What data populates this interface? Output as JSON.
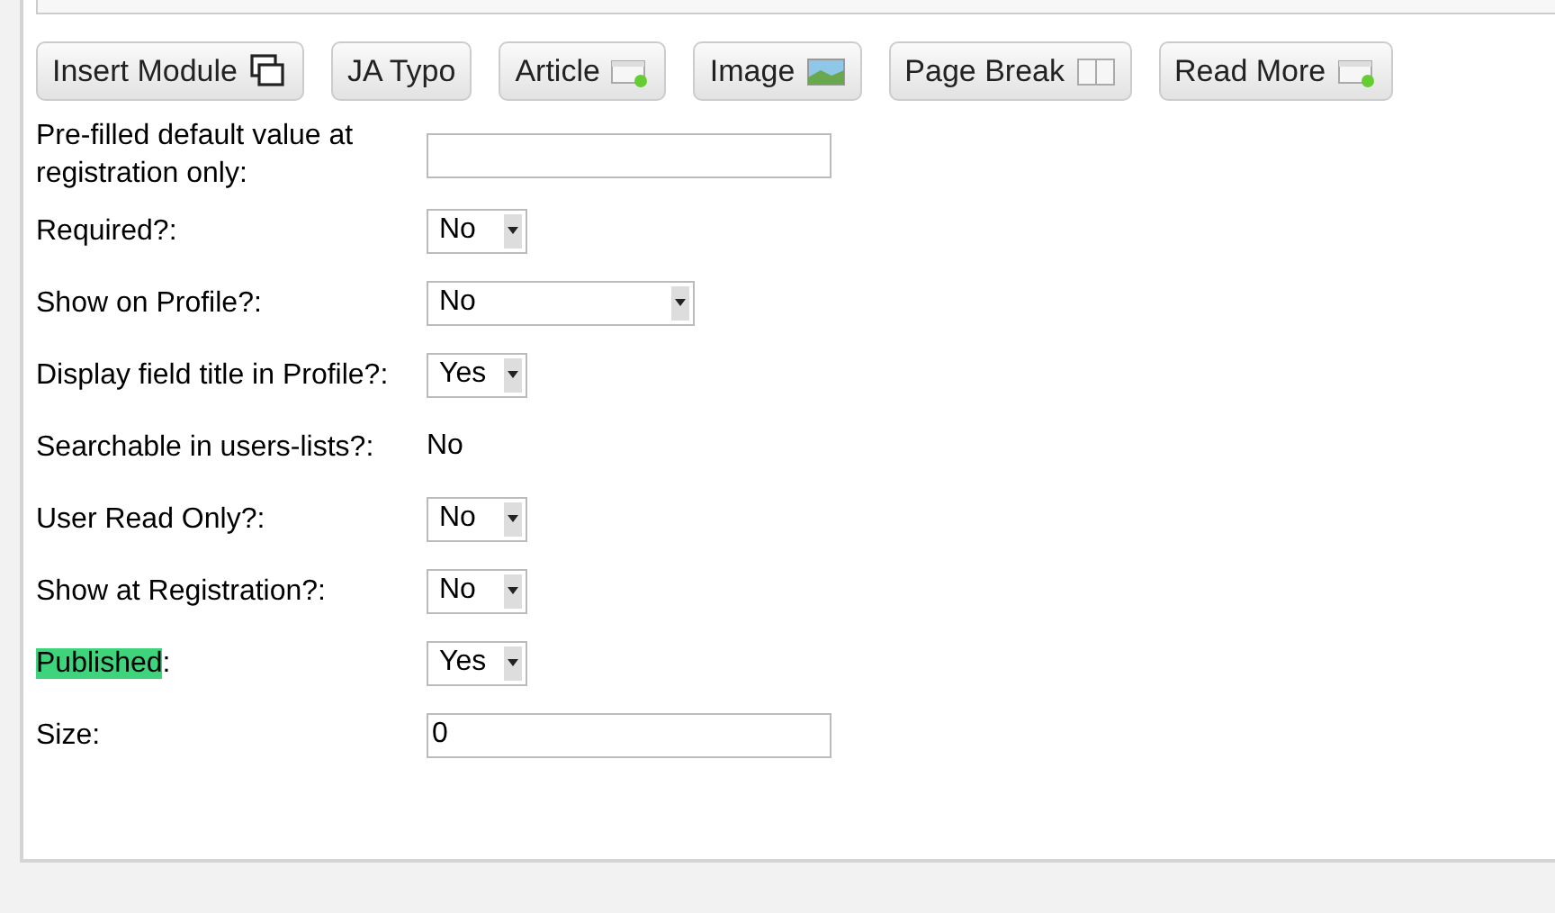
{
  "toolbar": [
    {
      "label": "Insert Module"
    },
    {
      "label": "JA Typo"
    },
    {
      "label": "Article"
    },
    {
      "label": "Image"
    },
    {
      "label": "Page Break"
    },
    {
      "label": "Read More"
    }
  ],
  "fields": [
    {
      "label": "Pre-filled default value at registration only:",
      "kind": "text"
    },
    {
      "label": "Required?:",
      "kind": "select",
      "value": "No"
    },
    {
      "label": "Show on Profile?:",
      "kind": "select-wide",
      "value": "No"
    },
    {
      "label": "Display field title in Profile?:",
      "kind": "select",
      "value": "Yes"
    },
    {
      "label": "Searchable in users-lists?:",
      "kind": "static",
      "value": "No"
    },
    {
      "label": "User Read Only?:",
      "kind": "select",
      "value": "No"
    },
    {
      "label": "Show at Registration?:",
      "kind": "select",
      "value": "No"
    },
    {
      "label": "Published",
      "highlighted": true,
      "suffix": ":",
      "kind": "select",
      "value": "Yes"
    },
    {
      "label": "Size:",
      "kind": "text",
      "value": "0"
    }
  ]
}
